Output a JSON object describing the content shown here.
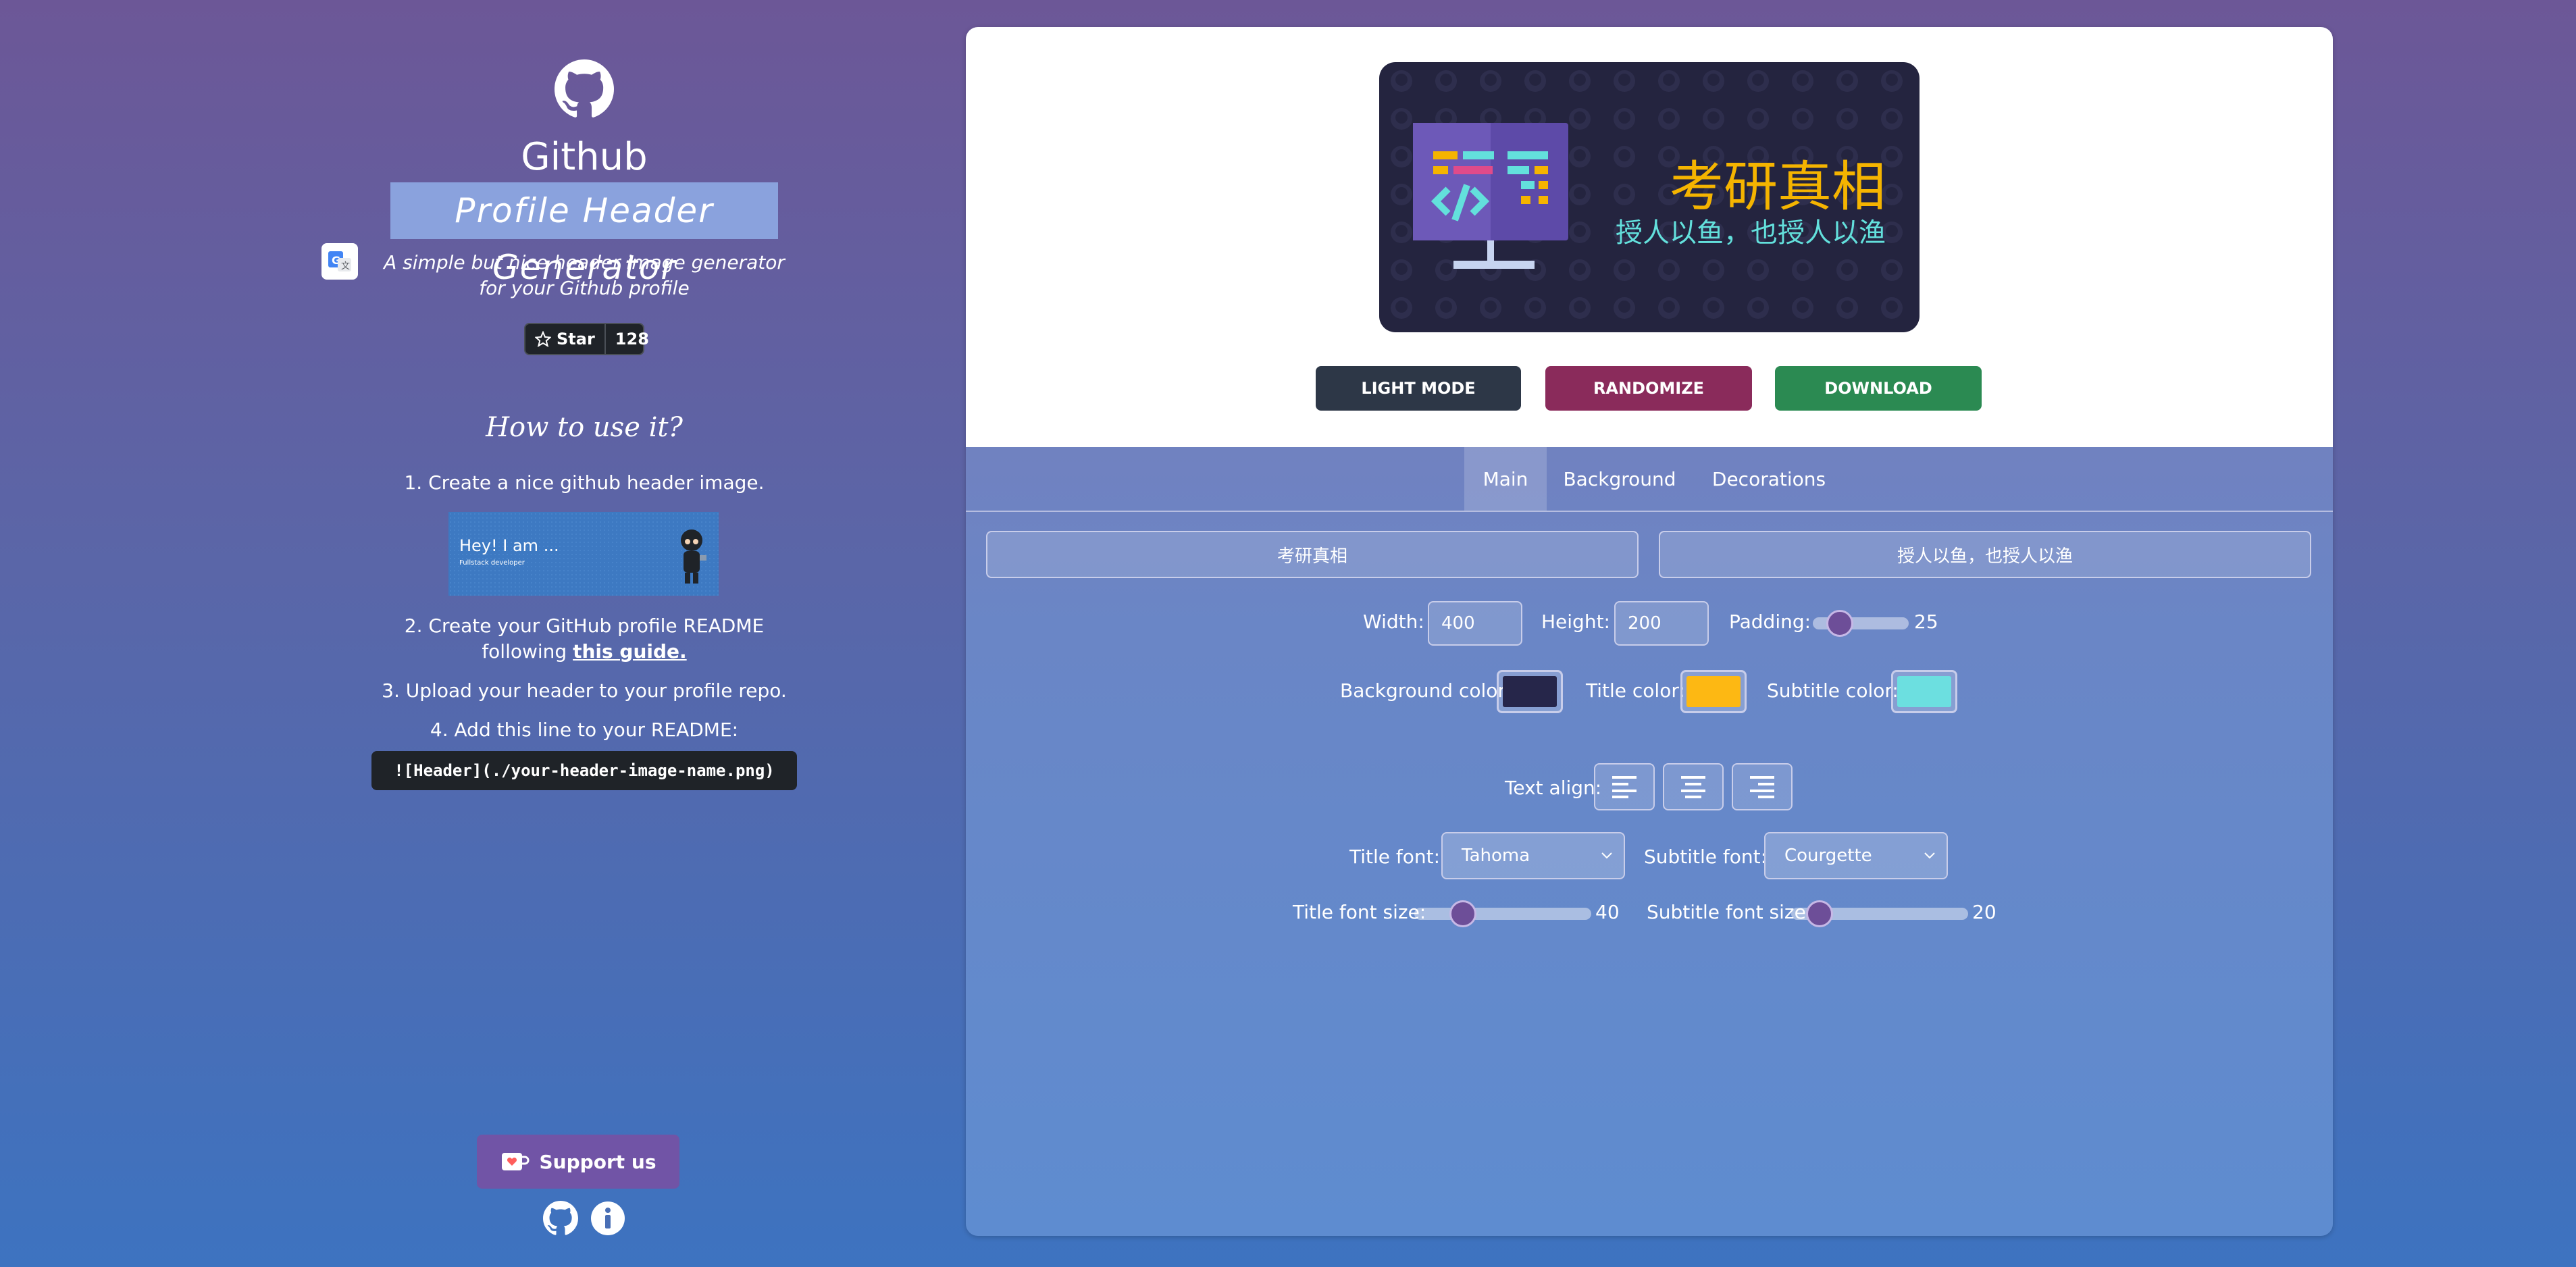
{
  "sidebar": {
    "title": "Github",
    "subtitle": "Profile Header Generator",
    "tagline_line1": "A simple but nice header image generator",
    "tagline_line2": "for your Github profile",
    "star_label": "Star",
    "star_count": "128",
    "howto_title": "How to use it?",
    "step1": "1. Create a nice github header image.",
    "preview_hi": "Hey! I am ...",
    "preview_role": "Fullstack developer",
    "step2_line1": "2. Create your GitHub profile README",
    "step2_prefix": "following ",
    "step2_link": "this guide.",
    "step3": "3. Upload your header to your profile repo.",
    "step4": "4. Add this line to your README:",
    "code": "![Header](./your-header-image-name.png)",
    "support_label": "Support us"
  },
  "banner": {
    "title": "考研真相",
    "subtitle": "授人以鱼，也授人以渔",
    "background": "#24243f",
    "title_color": "#f5b400",
    "subtitle_color": "#63e0dc"
  },
  "actions": {
    "light_mode": "LIGHT MODE",
    "randomize": "RANDOMIZE",
    "download": "DOWNLOAD"
  },
  "tabs": [
    "Main",
    "Background",
    "Decorations"
  ],
  "active_tab": "Main",
  "form": {
    "title_value": "考研真相",
    "subtitle_value": "授人以鱼，也授人以渔",
    "width_label": "Width:",
    "width_value": "400",
    "height_label": "Height:",
    "height_value": "200",
    "padding_label": "Padding:",
    "padding_value": "25",
    "bg_color_label": "Background color:",
    "bg_color": "#26264a",
    "title_color_label": "Title color:",
    "title_color": "#fdb813",
    "subtitle_color_label": "Subtitle color:",
    "subtitle_color": "#6cdfe0",
    "text_align_label": "Text align:",
    "title_font_label": "Title font:",
    "title_font_value": "Tahoma",
    "subtitle_font_label": "Subtitle font:",
    "subtitle_font_value": "Courgette",
    "title_size_label": "Title font size:",
    "title_size_value": "40",
    "subtitle_size_label": "Subtitle font size:",
    "subtitle_size_value": "20"
  }
}
